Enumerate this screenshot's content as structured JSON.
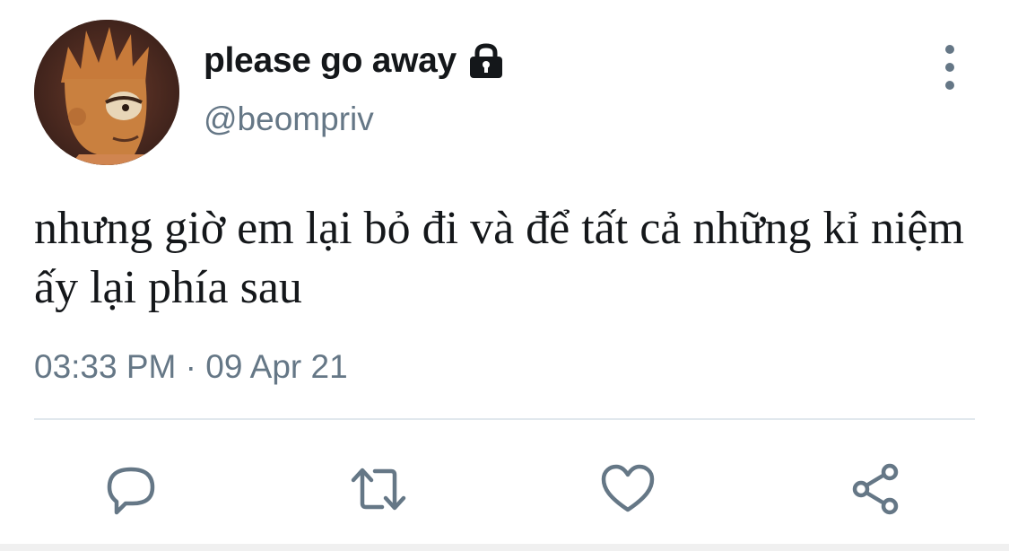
{
  "user": {
    "display_name": "please go away",
    "handle": "@beompriv",
    "locked_icon": "lock-icon",
    "avatar_icon": "avatar"
  },
  "tweet": {
    "text": "nhưng giờ em lại bỏ đi và để tất cả những kỉ niệm ấy lại phía sau",
    "timestamp": "03:33 PM · 09 Apr 21"
  },
  "menu": {
    "icon": "more-vertical-icon"
  },
  "actions": [
    {
      "name": "reply",
      "icon": "comment-icon"
    },
    {
      "name": "retweet",
      "icon": "retweet-icon"
    },
    {
      "name": "like",
      "icon": "heart-icon"
    },
    {
      "name": "share",
      "icon": "share-icon"
    }
  ],
  "colors": {
    "text_primary": "#14171a",
    "text_secondary": "#657786",
    "divider": "#e1e8ed"
  }
}
